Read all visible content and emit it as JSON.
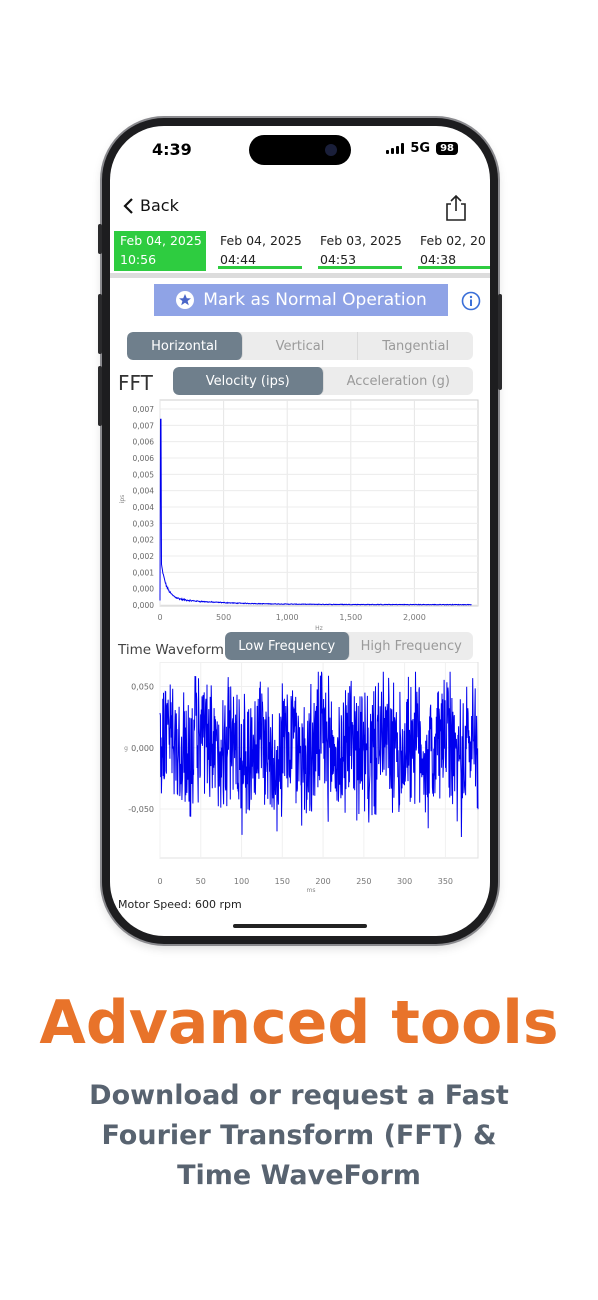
{
  "status": {
    "time": "4:39",
    "network": "5G",
    "battery": "98"
  },
  "nav": {
    "back_label": "Back"
  },
  "dates": [
    {
      "date": "Feb 04, 2025",
      "time": "10:56",
      "active": true
    },
    {
      "date": "Feb 04, 2025",
      "time": "04:44",
      "active": false
    },
    {
      "date": "Feb 03, 2025",
      "time": "04:53",
      "active": false
    },
    {
      "date": "Feb 02, 20",
      "time": "04:38",
      "active": false
    }
  ],
  "mark_button": {
    "label": "Mark as Normal Operation"
  },
  "axis_tabs": {
    "horizontal": "Horizontal",
    "vertical": "Vertical",
    "tangential": "Tangential"
  },
  "fft": {
    "title": "FFT",
    "tab_velocity": "Velocity (ips)",
    "tab_acceleration": "Acceleration (g)"
  },
  "waveform": {
    "title": "Time Waveform",
    "tab_low": "Low Frequency",
    "tab_high": "High Frequency"
  },
  "motor_speed": "Motor Speed: 600 rpm",
  "headline": "Advanced tools",
  "subtext": [
    "Download or request a Fast",
    "Fourier Transform (FFT) &",
    "Time WaveForm"
  ],
  "colors": {
    "accent_green": "#2ecc40",
    "series_blue": "#0000ee",
    "headline_orange": "#e8732a",
    "mark_button": "#8fa3e6"
  },
  "chart_data": [
    {
      "type": "line",
      "name": "fft",
      "x_ticks": [
        "0",
        "500",
        "1,000",
        "1,500",
        "2,000"
      ],
      "y_ticks": [
        "0,000",
        "0,000",
        "0,001",
        "0,002",
        "0,002",
        "0,003",
        "0,004",
        "0,004",
        "0,005",
        "0,006",
        "0,006",
        "0,007",
        "0,007"
      ],
      "xlabel": "Hz",
      "ylabel": "ips",
      "xlim": [
        0,
        2500
      ],
      "ylim": [
        0,
        0.0075
      ],
      "peak": {
        "x": 5,
        "y": 0.0068
      }
    },
    {
      "type": "line",
      "name": "time_waveform",
      "x_ticks": [
        "0",
        "50",
        "100",
        "150",
        "200",
        "250",
        "300",
        "350"
      ],
      "y_ticks": [
        "0,050",
        "0,000",
        "-0,050"
      ],
      "xlabel": "ms",
      "ylabel": "g",
      "xlim": [
        0,
        390
      ],
      "ylim": [
        -0.09,
        0.07
      ],
      "amplitude": 0.05
    }
  ]
}
